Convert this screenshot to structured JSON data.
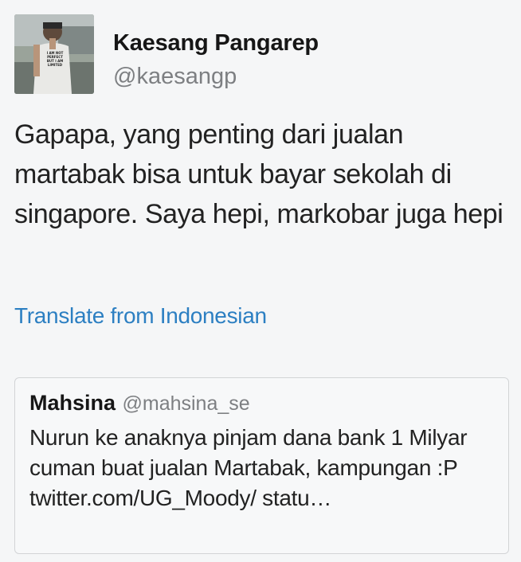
{
  "author": {
    "display_name": "Kaesang Pangarep",
    "handle": "@kaesangp",
    "avatar_icon": "profile-photo",
    "avatar_shirt_text": [
      "I AM NOT",
      "PERFECT",
      "BUT I AM",
      "LIMITED"
    ]
  },
  "tweet": {
    "text": "Gapapa, yang penting dari jualan martabak bisa untuk bayar sekolah di singapore. Saya hepi, markobar juga hepi",
    "translate_label": "Translate from Indonesian"
  },
  "quoted": {
    "display_name": "Mahsina",
    "handle": "@mahsina_se",
    "text": "Nurun ke anaknya pinjam dana bank 1 Milyar cuman buat jualan Martabak, kampungan :P twitter.com/UG_Moody/ statu…"
  },
  "colors": {
    "background": "#f5f6f7",
    "link": "#2c7fc2",
    "muted": "#7d7f82",
    "text": "#222222",
    "card_border": "#d2d4d6"
  }
}
